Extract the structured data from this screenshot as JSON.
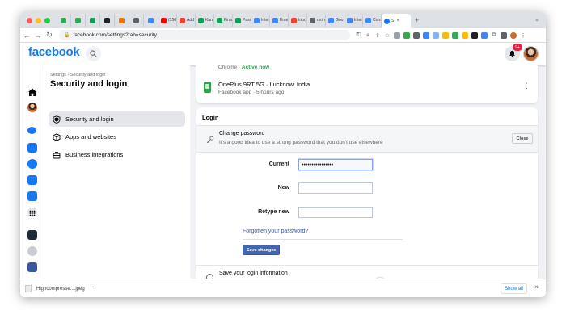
{
  "browser": {
    "tabs": [
      {
        "label": "",
        "color": "#34a853"
      },
      {
        "label": "",
        "color": "#34a853"
      },
      {
        "label": "",
        "color": "#0f9d58"
      },
      {
        "label": "",
        "color": "#202124"
      },
      {
        "label": "",
        "color": "#e37400"
      },
      {
        "label": "",
        "color": "#5f6368"
      },
      {
        "label": "",
        "color": "#4285f4"
      },
      {
        "label": "(150",
        "color": "#ff0000"
      },
      {
        "label": "Add",
        "color": "#ea4335"
      },
      {
        "label": "Kara",
        "color": "#0f9d58"
      },
      {
        "label": "Final",
        "color": "#0f9d58"
      },
      {
        "label": "Pass",
        "color": "#0f9d58"
      },
      {
        "label": "Inter",
        "color": "#4285f4"
      },
      {
        "label": "Ente",
        "color": "#4285f4"
      },
      {
        "label": "Inbo",
        "color": "#ea4335"
      },
      {
        "label": "mohi",
        "color": "#5f6368"
      },
      {
        "label": "Goo",
        "color": "#4285f4"
      },
      {
        "label": "Inter",
        "color": "#4285f4"
      },
      {
        "label": "Com",
        "color": "#4285f4"
      }
    ],
    "active_tab": {
      "label": "S",
      "color": "#1877f2"
    },
    "url": "facebook.com/settings?tab=security"
  },
  "header": {
    "logo": "facebook",
    "notif_count": "9+"
  },
  "sidebar": {
    "breadcrumb": "Settings › Security and login",
    "title": "Security and login",
    "items": [
      {
        "label": "Security and login",
        "icon": "shield-icon",
        "selected": true
      },
      {
        "label": "Apps and websites",
        "icon": "box-icon",
        "selected": false
      },
      {
        "label": "Business integrations",
        "icon": "briefcase-icon",
        "selected": false
      }
    ]
  },
  "sessions": {
    "chrome_browser": "Chrome",
    "chrome_status": "Active now",
    "device_name": "OnePlus 9RT 5G · Lucknow, India",
    "device_sub": "Facebook app · 5 hours ago"
  },
  "login": {
    "heading": "Login",
    "change_password_title": "Change password",
    "change_password_desc": "It's a good idea to use a strong password that you don't use elsewhere",
    "close_label": "Close",
    "current_label": "Current",
    "current_value": "••••••••••••••••",
    "new_label": "New",
    "new_value": "",
    "retype_label": "Retype new",
    "retype_value": "",
    "forgot_link": "Forgotten your password?",
    "save_label": "Save changes",
    "next_section": "Save your login information"
  },
  "downloads": {
    "file": "Highcompresse....jpeg",
    "show_all": "Show all"
  },
  "colors": {
    "brand": "#1877f2",
    "save_button": "#4267b2",
    "active_status": "#31a24c",
    "badge": "#e41e3f"
  }
}
